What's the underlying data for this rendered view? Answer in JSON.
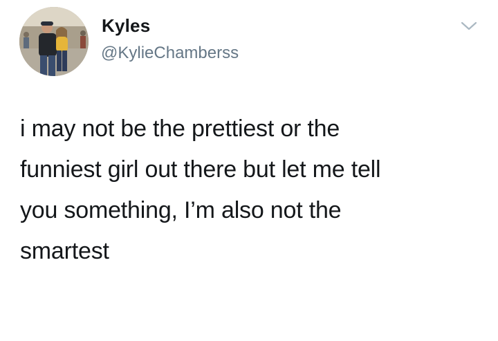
{
  "tweet": {
    "author": {
      "display_name": "Kyles",
      "handle": "@KylieChamberss",
      "avatar": "profile-photo-couple"
    },
    "menu_icon": "chevron-down-icon",
    "text_lines": [
      "i may not be the prettiest or the",
      "funniest girl out there but let me tell",
      "you something, I’m also not the",
      "smartest"
    ]
  },
  "colors": {
    "background": "#ffffff",
    "text_primary": "#14171a",
    "text_secondary": "#657786",
    "caret": "#aab8c2"
  }
}
